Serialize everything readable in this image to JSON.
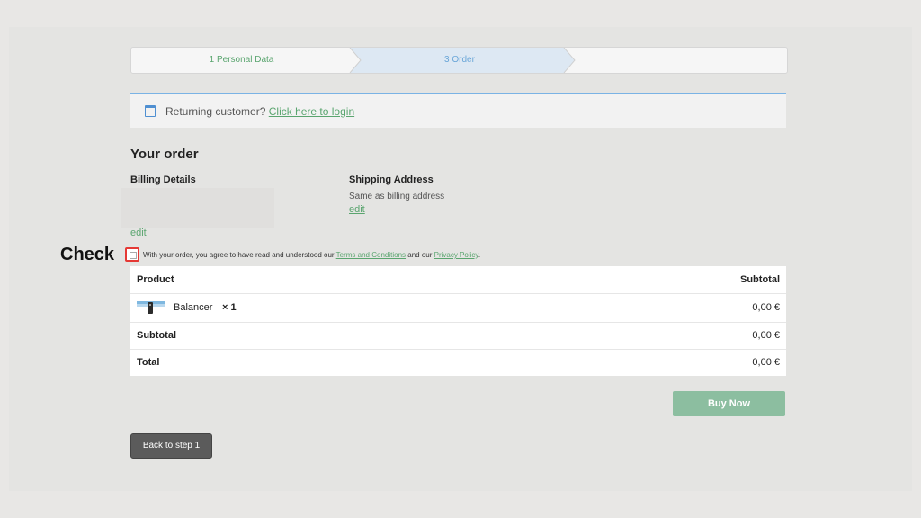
{
  "steps": {
    "step1": "1 Personal Data",
    "step2": "3 Order",
    "step3": ""
  },
  "notice": {
    "text": "Returning customer?",
    "link": "Click here to login"
  },
  "order": {
    "title": "Your order",
    "billing_title": "Billing Details",
    "billing_edit": "edit",
    "shipping_title": "Shipping Address",
    "shipping_same": "Same as billing address",
    "shipping_edit": "edit"
  },
  "annotation": {
    "label": "Check",
    "color": "#e53935"
  },
  "agreement": {
    "prefix": "With your order, you agree to have read and understood our",
    "terms": "Terms and Conditions",
    "middle": "and our",
    "privacy": "Privacy Policy",
    "suffix": "."
  },
  "table": {
    "headers": {
      "product": "Product",
      "subtotal": "Subtotal"
    },
    "items": [
      {
        "name": "Balancer",
        "qty": "× 1",
        "price": "0,00 €",
        "icon": "product-thumbnail"
      }
    ],
    "subtotal_label": "Subtotal",
    "subtotal_value": "0,00 €",
    "total_label": "Total",
    "total_value": "0,00 €"
  },
  "buttons": {
    "buy": "Buy Now",
    "back": "Back to step 1"
  },
  "colors": {
    "accent_green": "#5aa56f",
    "accent_blue": "#6aa6d8",
    "buy_button": "#8cbea0"
  }
}
